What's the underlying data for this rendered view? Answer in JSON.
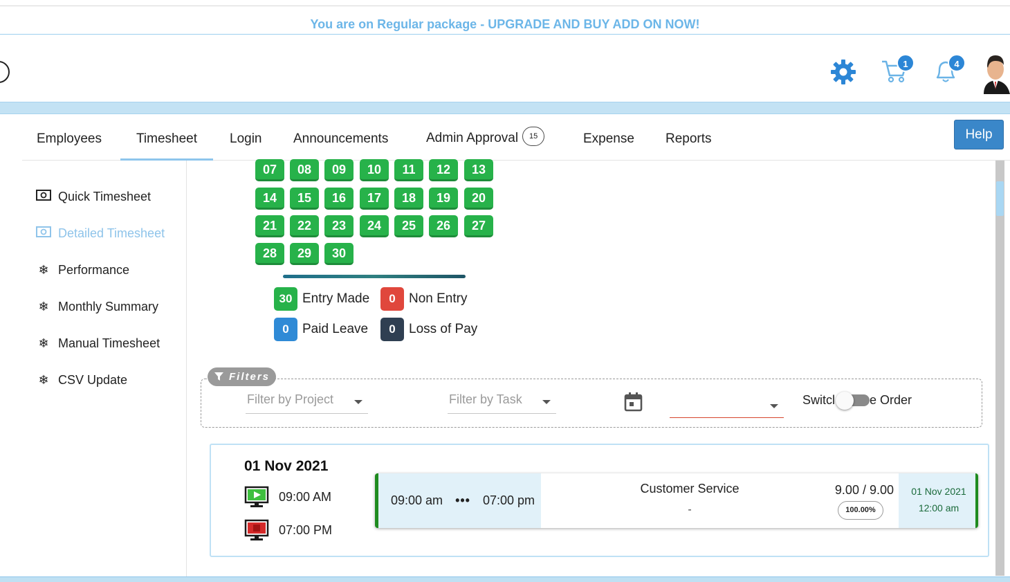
{
  "banner": {
    "text": "You are on Regular package - UPGRADE AND BUY ADD ON NOW!"
  },
  "header": {
    "icons": [
      "gear-icon",
      "cart-icon",
      "bell-icon",
      "user-avatar"
    ],
    "cart_count": "1",
    "notification_count": "4",
    "colors": {
      "accent": "#2c86d6",
      "banner": "#6cb6e8"
    }
  },
  "tabs": [
    {
      "label": "Employees"
    },
    {
      "label": "Timesheet",
      "active": true
    },
    {
      "label": "Login"
    },
    {
      "label": "Announcements"
    },
    {
      "label": "Admin Approval",
      "count": "15"
    },
    {
      "label": "Expense"
    },
    {
      "label": "Reports"
    }
  ],
  "help_label": "Help",
  "sidebar": {
    "items": [
      {
        "label": "Quick Timesheet",
        "icon": "money-icon"
      },
      {
        "label": "Detailed Timesheet",
        "icon": "money-icon",
        "active": true
      },
      {
        "label": "Performance",
        "icon": "snowflake-icon"
      },
      {
        "label": "Monthly Summary",
        "icon": "snowflake-icon"
      },
      {
        "label": "Manual Timesheet",
        "icon": "snowflake-icon"
      },
      {
        "label": "CSV Update",
        "icon": "snowflake-icon"
      }
    ]
  },
  "calendar": {
    "days": [
      "07",
      "08",
      "09",
      "10",
      "11",
      "12",
      "13",
      "14",
      "15",
      "16",
      "17",
      "18",
      "19",
      "20",
      "21",
      "22",
      "23",
      "24",
      "25",
      "26",
      "27",
      "28",
      "29",
      "30"
    ],
    "day_color": "#27b24a"
  },
  "legend": [
    {
      "count": "30",
      "label": "Entry Made",
      "color": "#27b24a"
    },
    {
      "count": "0",
      "label": "Non Entry",
      "color": "#e0473c"
    },
    {
      "count": "0",
      "label": "Paid Leave",
      "color": "#2f8ad6"
    },
    {
      "count": "0",
      "label": "Loss of Pay",
      "color": "#2f3f52"
    }
  ],
  "filters": {
    "tag": "Filters",
    "project_placeholder": "Filter by Project",
    "task_placeholder": "Filter by Task",
    "date_value": "",
    "switch_label_left": "Switcl",
    "switch_label_right": "e Order"
  },
  "entry": {
    "date": "01 Nov 2021",
    "clock_in": "09:00 AM",
    "clock_out": "07:00 PM",
    "log": {
      "start": "09:00 am",
      "dots": "•••",
      "end": "07:00 pm",
      "project": "Customer Service",
      "task": "-",
      "hours": "9.00 / 9.00",
      "percent": "100.00%",
      "entry_date": "01 Nov 2021",
      "entry_time": "12:00 am"
    }
  }
}
